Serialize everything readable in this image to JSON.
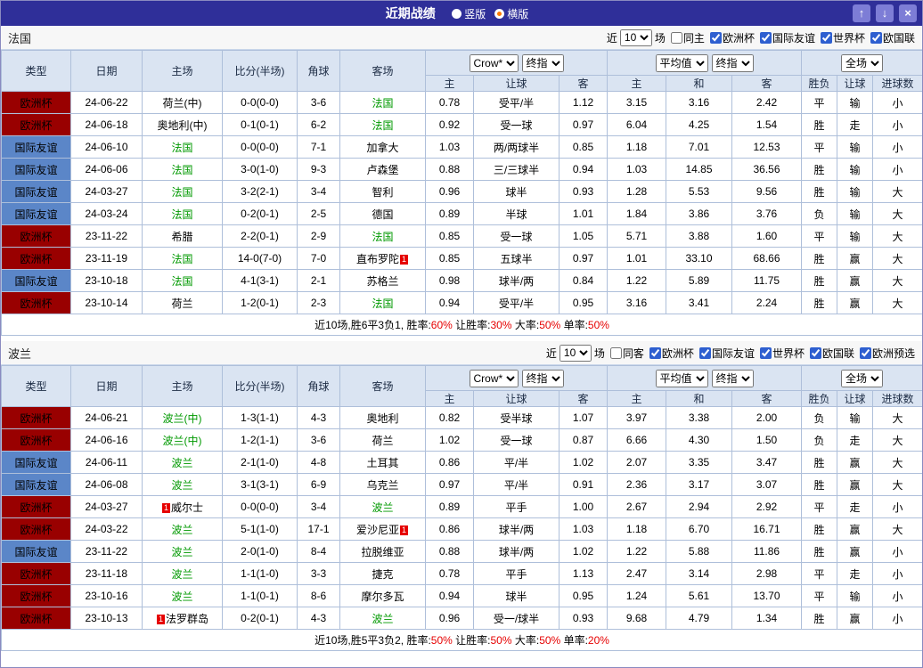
{
  "titlebar": {
    "title": "近期战绩",
    "radios": [
      {
        "label": "竖版",
        "selected": false
      },
      {
        "label": "横版",
        "selected": true
      }
    ],
    "buttons": {
      "up": "↑",
      "down": "↓",
      "close": "×"
    }
  },
  "colors": {
    "titlebar_bg": "#2f2f99",
    "header_bg": "#dae4f2",
    "score_red": "#e60000",
    "team_green": "#009900",
    "win_red": "#e60000",
    "draw_green": "#009933",
    "lose_blue": "#2233cc",
    "radio_dot_orange": "#ff7a00"
  },
  "type_colors": {
    "欧洲杯": "#990000",
    "国际友谊": "#5b86c8"
  },
  "table_header": {
    "cols": [
      "类型",
      "日期",
      "主场",
      "比分(半场)",
      "角球",
      "客场"
    ],
    "ah_selects": [
      "Crow*",
      "终指"
    ],
    "ah_cols": [
      "主",
      "让球",
      "客"
    ],
    "eu_selects": [
      "平均值",
      "终指"
    ],
    "eu_cols": [
      "主",
      "和",
      "客"
    ],
    "scope_select": "全场",
    "result_cols": [
      "胜负",
      "让球",
      "进球数"
    ]
  },
  "sections": [
    {
      "team": "法国",
      "filter": {
        "near": "近",
        "count": "10",
        "games": "场",
        "same": "同主",
        "same_checked": false,
        "comps": [
          {
            "label": "欧洲杯",
            "checked": true
          },
          {
            "label": "国际友谊",
            "checked": true
          },
          {
            "label": "世界杯",
            "checked": true
          },
          {
            "label": "欧国联",
            "checked": true
          }
        ]
      },
      "rows": [
        {
          "type": "欧洲杯",
          "date": "24-06-22",
          "home": {
            "n": "荷兰(中)"
          },
          "score": "0-0(0-0)",
          "corner": "3-6",
          "away": {
            "n": "法国",
            "g": 1
          },
          "ah": [
            "0.78",
            "受平/半",
            "1.12"
          ],
          "eu": [
            "3.15",
            "3.16",
            "2.42"
          ],
          "res": [
            [
              "平",
              "g"
            ],
            [
              "输",
              "b"
            ],
            [
              "小",
              "b"
            ]
          ]
        },
        {
          "type": "欧洲杯",
          "date": "24-06-18",
          "home": {
            "n": "奥地利(中)"
          },
          "score": "0-1(0-1)",
          "corner": "6-2",
          "away": {
            "n": "法国",
            "g": 1
          },
          "ah": [
            "0.92",
            "受一球",
            "0.97"
          ],
          "eu": [
            "6.04",
            "4.25",
            "1.54"
          ],
          "res": [
            [
              "胜",
              "r"
            ],
            [
              "走",
              "g"
            ],
            [
              "小",
              "b"
            ]
          ]
        },
        {
          "type": "国际友谊",
          "date": "24-06-10",
          "home": {
            "n": "法国",
            "g": 1
          },
          "score": "0-0(0-0)",
          "corner": "7-1",
          "away": {
            "n": "加拿大"
          },
          "ah": [
            "1.03",
            "两/两球半",
            "0.85"
          ],
          "eu": [
            "1.18",
            "7.01",
            "12.53"
          ],
          "res": [
            [
              "平",
              "g"
            ],
            [
              "输",
              "b"
            ],
            [
              "小",
              "b"
            ]
          ]
        },
        {
          "type": "国际友谊",
          "date": "24-06-06",
          "home": {
            "n": "法国",
            "g": 1
          },
          "score": "3-0(1-0)",
          "corner": "9-3",
          "away": {
            "n": "卢森堡"
          },
          "ah": [
            "0.88",
            "三/三球半",
            "0.94"
          ],
          "eu": [
            "1.03",
            "14.85",
            "36.56"
          ],
          "res": [
            [
              "胜",
              "r"
            ],
            [
              "输",
              "b"
            ],
            [
              "小",
              "b"
            ]
          ]
        },
        {
          "type": "国际友谊",
          "date": "24-03-27",
          "home": {
            "n": "法国",
            "g": 1
          },
          "score": "3-2(2-1)",
          "corner": "3-4",
          "away": {
            "n": "智利"
          },
          "ah": [
            "0.96",
            "球半",
            "0.93"
          ],
          "eu": [
            "1.28",
            "5.53",
            "9.56"
          ],
          "res": [
            [
              "胜",
              "r"
            ],
            [
              "输",
              "b"
            ],
            [
              "大",
              "r"
            ]
          ]
        },
        {
          "type": "国际友谊",
          "date": "24-03-24",
          "home": {
            "n": "法国",
            "g": 1
          },
          "score": "0-2(0-1)",
          "corner": "2-5",
          "away": {
            "n": "德国"
          },
          "ah": [
            "0.89",
            "半球",
            "1.01"
          ],
          "eu": [
            "1.84",
            "3.86",
            "3.76"
          ],
          "res": [
            [
              "负",
              "b"
            ],
            [
              "输",
              "b"
            ],
            [
              "大",
              "r"
            ]
          ]
        },
        {
          "type": "欧洲杯",
          "date": "23-11-22",
          "home": {
            "n": "希腊"
          },
          "score": "2-2(0-1)",
          "corner": "2-9",
          "away": {
            "n": "法国",
            "g": 1
          },
          "ah": [
            "0.85",
            "受一球",
            "1.05"
          ],
          "eu": [
            "5.71",
            "3.88",
            "1.60"
          ],
          "res": [
            [
              "平",
              "g"
            ],
            [
              "输",
              "b"
            ],
            [
              "大",
              "r"
            ]
          ]
        },
        {
          "type": "欧洲杯",
          "date": "23-11-19",
          "home": {
            "n": "法国",
            "g": 1
          },
          "score": "14-0(7-0)",
          "corner": "7-0",
          "away": {
            "n": "直布罗陀",
            "b": "1",
            "bs": "after"
          },
          "ah": [
            "0.85",
            "五球半",
            "0.97"
          ],
          "eu": [
            "1.01",
            "33.10",
            "68.66"
          ],
          "res": [
            [
              "胜",
              "r"
            ],
            [
              "赢",
              "r"
            ],
            [
              "大",
              "r"
            ]
          ]
        },
        {
          "type": "国际友谊",
          "date": "23-10-18",
          "home": {
            "n": "法国",
            "g": 1
          },
          "score": "4-1(3-1)",
          "corner": "2-1",
          "away": {
            "n": "苏格兰"
          },
          "ah": [
            "0.98",
            "球半/两",
            "0.84"
          ],
          "eu": [
            "1.22",
            "5.89",
            "11.75"
          ],
          "res": [
            [
              "胜",
              "r"
            ],
            [
              "赢",
              "r"
            ],
            [
              "大",
              "r"
            ]
          ]
        },
        {
          "type": "欧洲杯",
          "date": "23-10-14",
          "home": {
            "n": "荷兰"
          },
          "score": "1-2(0-1)",
          "corner": "2-3",
          "away": {
            "n": "法国",
            "g": 1
          },
          "ah": [
            "0.94",
            "受平/半",
            "0.95"
          ],
          "eu": [
            "3.16",
            "3.41",
            "2.24"
          ],
          "res": [
            [
              "胜",
              "r"
            ],
            [
              "赢",
              "r"
            ],
            [
              "大",
              "r"
            ]
          ]
        }
      ],
      "summary": [
        {
          "t": "近10场,胜6平3负1, 胜率:",
          "c": "k"
        },
        {
          "t": "60%",
          "c": "r"
        },
        {
          "t": " 让胜率:",
          "c": "k"
        },
        {
          "t": "30%",
          "c": "r"
        },
        {
          "t": " 大率:",
          "c": "k"
        },
        {
          "t": "50%",
          "c": "r"
        },
        {
          "t": " 单率:",
          "c": "k"
        },
        {
          "t": "50%",
          "c": "r"
        }
      ]
    },
    {
      "team": "波兰",
      "filter": {
        "near": "近",
        "count": "10",
        "games": "场",
        "same": "同客",
        "same_checked": false,
        "comps": [
          {
            "label": "欧洲杯",
            "checked": true
          },
          {
            "label": "国际友谊",
            "checked": true
          },
          {
            "label": "世界杯",
            "checked": true
          },
          {
            "label": "欧国联",
            "checked": true
          },
          {
            "label": "欧洲预选",
            "checked": true
          }
        ]
      },
      "rows": [
        {
          "type": "欧洲杯",
          "date": "24-06-21",
          "home": {
            "n": "波兰(中)",
            "g": 1
          },
          "score": "1-3(1-1)",
          "corner": "4-3",
          "away": {
            "n": "奥地利"
          },
          "ah": [
            "0.82",
            "受半球",
            "1.07"
          ],
          "eu": [
            "3.97",
            "3.38",
            "2.00"
          ],
          "res": [
            [
              "负",
              "b"
            ],
            [
              "输",
              "b"
            ],
            [
              "大",
              "r"
            ]
          ]
        },
        {
          "type": "欧洲杯",
          "date": "24-06-16",
          "home": {
            "n": "波兰(中)",
            "g": 1
          },
          "score": "1-2(1-1)",
          "corner": "3-6",
          "away": {
            "n": "荷兰"
          },
          "ah": [
            "1.02",
            "受一球",
            "0.87"
          ],
          "eu": [
            "6.66",
            "4.30",
            "1.50"
          ],
          "res": [
            [
              "负",
              "b"
            ],
            [
              "走",
              "g"
            ],
            [
              "大",
              "r"
            ]
          ]
        },
        {
          "type": "国际友谊",
          "date": "24-06-11",
          "home": {
            "n": "波兰",
            "g": 1
          },
          "score": "2-1(1-0)",
          "corner": "4-8",
          "away": {
            "n": "土耳其"
          },
          "ah": [
            "0.86",
            "平/半",
            "1.02"
          ],
          "eu": [
            "2.07",
            "3.35",
            "3.47"
          ],
          "res": [
            [
              "胜",
              "r"
            ],
            [
              "赢",
              "r"
            ],
            [
              "大",
              "r"
            ]
          ]
        },
        {
          "type": "国际友谊",
          "date": "24-06-08",
          "home": {
            "n": "波兰",
            "g": 1
          },
          "score": "3-1(3-1)",
          "corner": "6-9",
          "away": {
            "n": "乌克兰"
          },
          "ah": [
            "0.97",
            "平/半",
            "0.91"
          ],
          "eu": [
            "2.36",
            "3.17",
            "3.07"
          ],
          "res": [
            [
              "胜",
              "r"
            ],
            [
              "赢",
              "r"
            ],
            [
              "大",
              "r"
            ]
          ]
        },
        {
          "type": "欧洲杯",
          "date": "24-03-27",
          "home": {
            "n": "威尔士",
            "b": "1",
            "bs": "before"
          },
          "score": "0-0(0-0)",
          "corner": "3-4",
          "away": {
            "n": "波兰",
            "g": 1
          },
          "ah": [
            "0.89",
            "平手",
            "1.00"
          ],
          "eu": [
            "2.67",
            "2.94",
            "2.92"
          ],
          "res": [
            [
              "平",
              "g"
            ],
            [
              "走",
              "g"
            ],
            [
              "小",
              "b"
            ]
          ]
        },
        {
          "type": "欧洲杯",
          "date": "24-03-22",
          "home": {
            "n": "波兰",
            "g": 1
          },
          "score": "5-1(1-0)",
          "corner": "17-1",
          "away": {
            "n": "爱沙尼亚",
            "b": "1",
            "bs": "after"
          },
          "ah": [
            "0.86",
            "球半/两",
            "1.03"
          ],
          "eu": [
            "1.18",
            "6.70",
            "16.71"
          ],
          "res": [
            [
              "胜",
              "r"
            ],
            [
              "赢",
              "r"
            ],
            [
              "大",
              "r"
            ]
          ]
        },
        {
          "type": "国际友谊",
          "date": "23-11-22",
          "home": {
            "n": "波兰",
            "g": 1
          },
          "score": "2-0(1-0)",
          "corner": "8-4",
          "away": {
            "n": "拉脱维亚"
          },
          "ah": [
            "0.88",
            "球半/两",
            "1.02"
          ],
          "eu": [
            "1.22",
            "5.88",
            "11.86"
          ],
          "res": [
            [
              "胜",
              "r"
            ],
            [
              "赢",
              "r"
            ],
            [
              "小",
              "b"
            ]
          ]
        },
        {
          "type": "欧洲杯",
          "date": "23-11-18",
          "home": {
            "n": "波兰",
            "g": 1
          },
          "score": "1-1(1-0)",
          "corner": "3-3",
          "away": {
            "n": "捷克"
          },
          "ah": [
            "0.78",
            "平手",
            "1.13"
          ],
          "eu": [
            "2.47",
            "3.14",
            "2.98"
          ],
          "res": [
            [
              "平",
              "g"
            ],
            [
              "走",
              "g"
            ],
            [
              "小",
              "b"
            ]
          ]
        },
        {
          "type": "欧洲杯",
          "date": "23-10-16",
          "home": {
            "n": "波兰",
            "g": 1
          },
          "score": "1-1(0-1)",
          "corner": "8-6",
          "away": {
            "n": "摩尔多瓦"
          },
          "ah": [
            "0.94",
            "球半",
            "0.95"
          ],
          "eu": [
            "1.24",
            "5.61",
            "13.70"
          ],
          "res": [
            [
              "平",
              "g"
            ],
            [
              "输",
              "b"
            ],
            [
              "小",
              "b"
            ]
          ]
        },
        {
          "type": "欧洲杯",
          "date": "23-10-13",
          "home": {
            "n": "法罗群岛",
            "b": "1",
            "bs": "before"
          },
          "score": "0-2(0-1)",
          "corner": "4-3",
          "away": {
            "n": "波兰",
            "g": 1
          },
          "ah": [
            "0.96",
            "受一/球半",
            "0.93"
          ],
          "eu": [
            "9.68",
            "4.79",
            "1.34"
          ],
          "res": [
            [
              "胜",
              "r"
            ],
            [
              "赢",
              "r"
            ],
            [
              "小",
              "b"
            ]
          ]
        }
      ],
      "summary": [
        {
          "t": "近10场,胜5平3负2, 胜率:",
          "c": "k"
        },
        {
          "t": "50%",
          "c": "r"
        },
        {
          "t": " 让胜率:",
          "c": "k"
        },
        {
          "t": "50%",
          "c": "r"
        },
        {
          "t": " 大率:",
          "c": "k"
        },
        {
          "t": "50%",
          "c": "r"
        },
        {
          "t": " 单率:",
          "c": "k"
        },
        {
          "t": "20%",
          "c": "r"
        }
      ]
    }
  ]
}
